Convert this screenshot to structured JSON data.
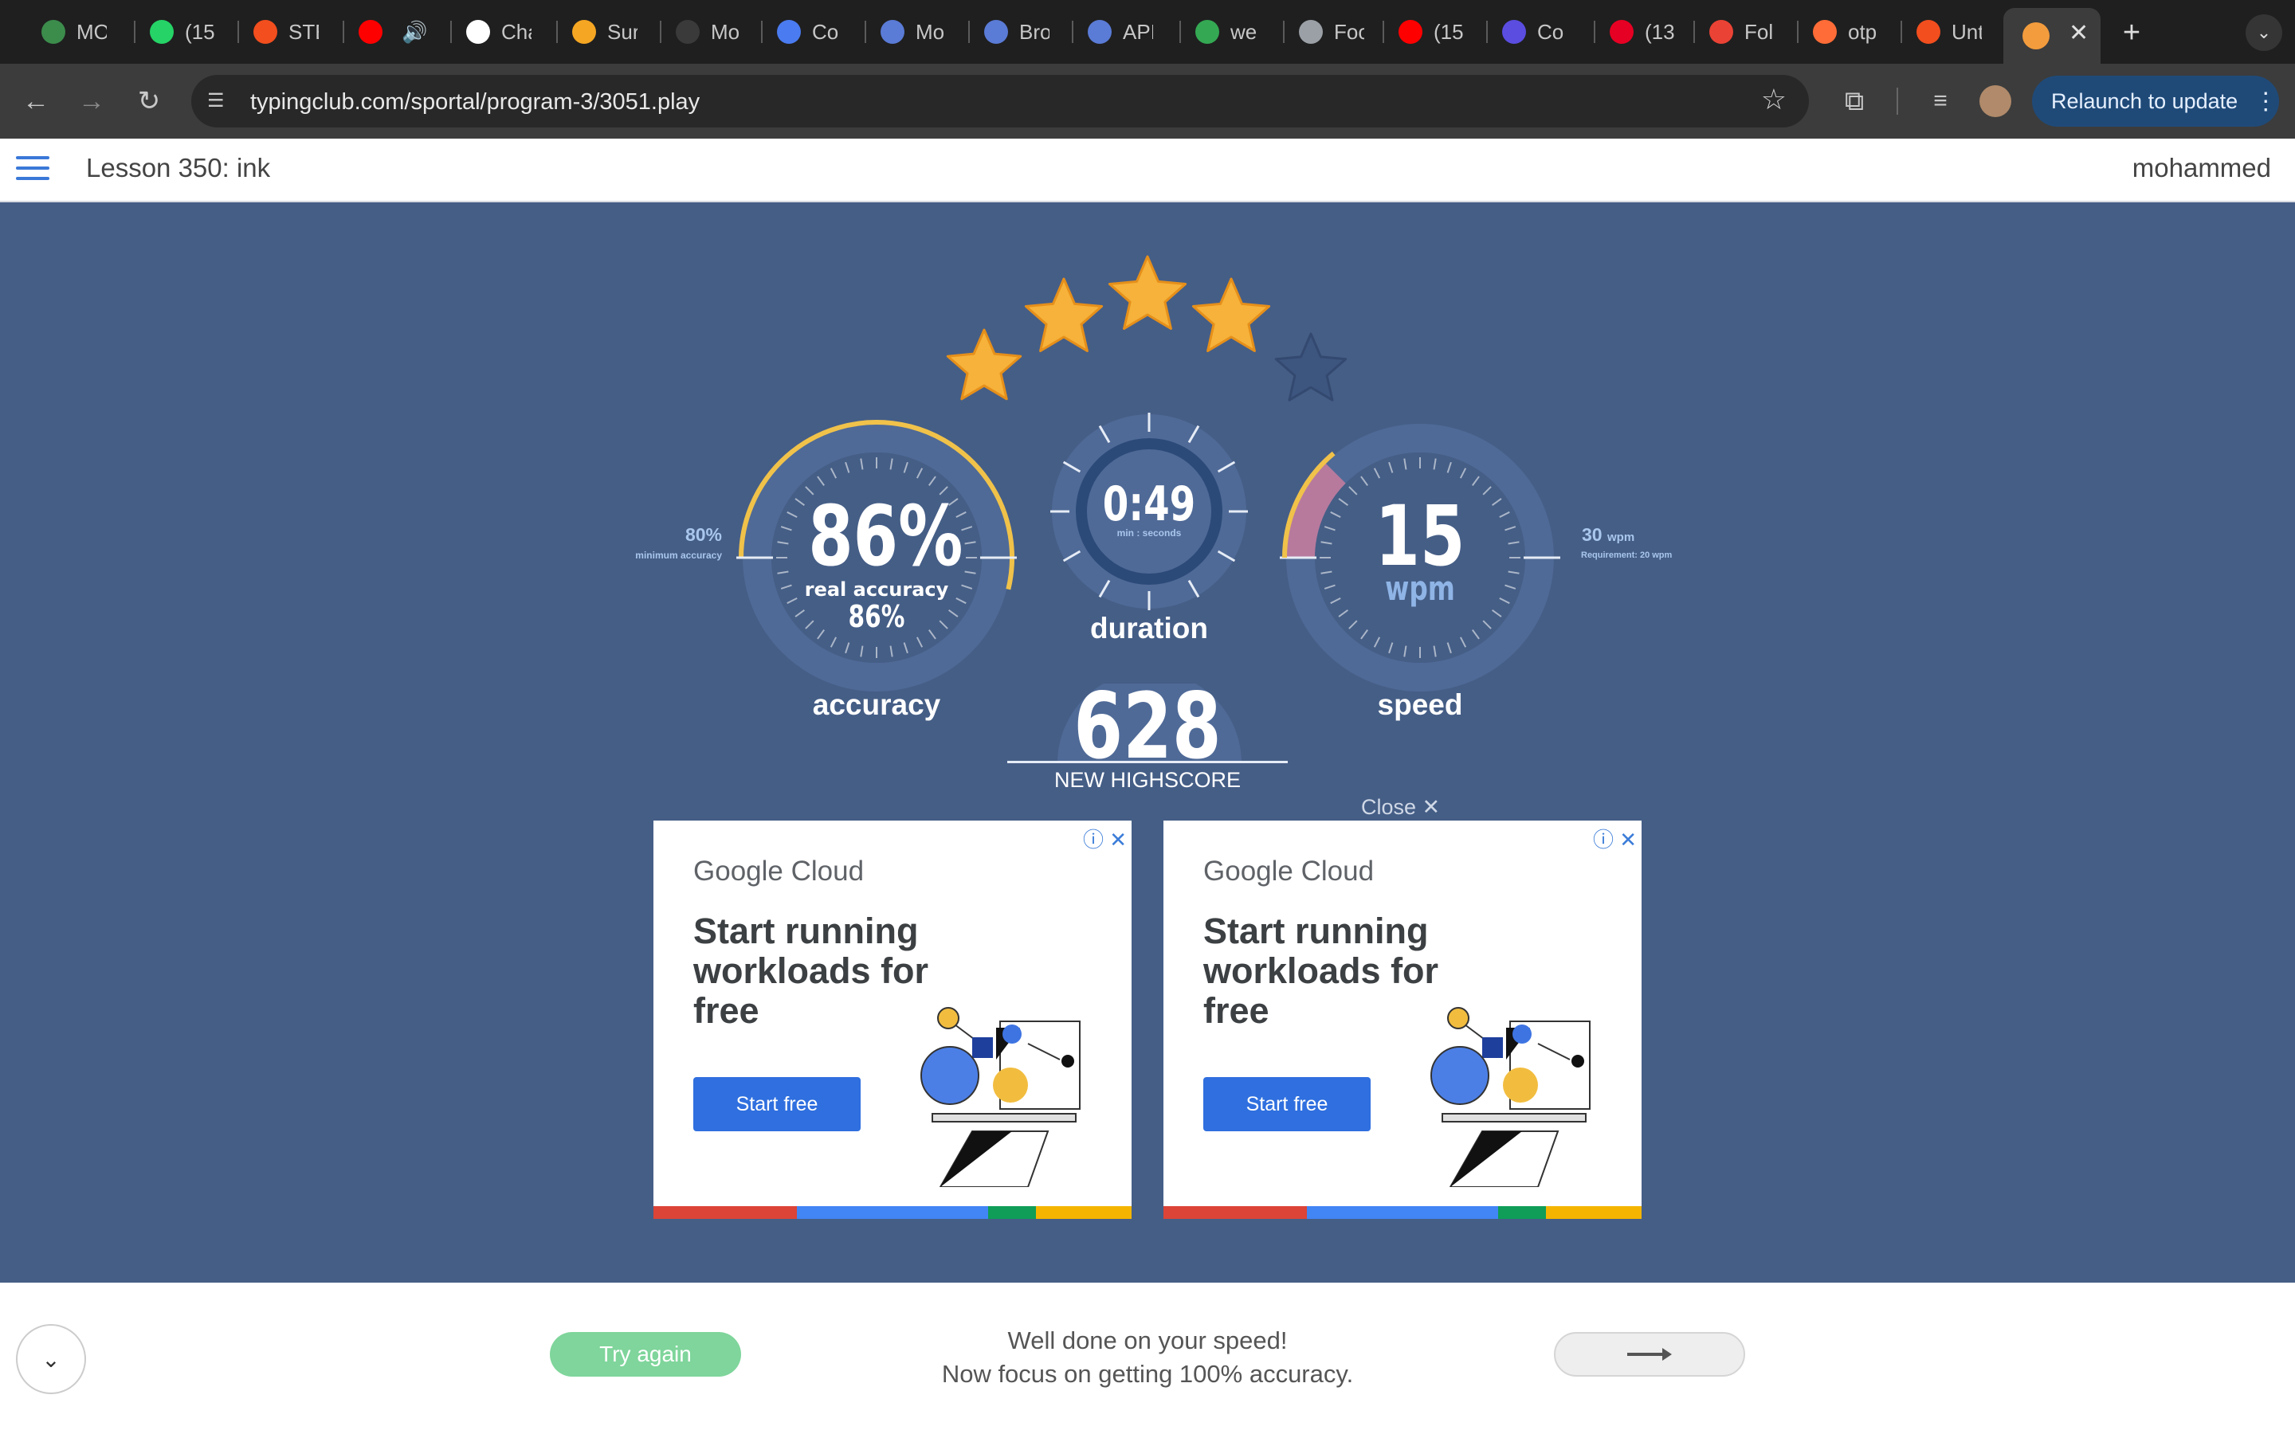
{
  "browser": {
    "tabs": [
      {
        "label": "MO",
        "icon": "globe-plus-icon",
        "color": "#3c8c4c"
      },
      {
        "label": "(15",
        "icon": "whatsapp-icon",
        "color": "#25d366"
      },
      {
        "label": "STE",
        "icon": "figma-icon",
        "color": "#f24e1e"
      },
      {
        "label": "",
        "icon": "youtube-icon",
        "color": "#ff0000"
      },
      {
        "label": "Cha",
        "icon": "chatgpt-icon",
        "color": "#ffffff"
      },
      {
        "label": "Sur",
        "icon": "surfshark-icon",
        "color": "#f5a623"
      },
      {
        "label": "Mo",
        "icon": "mt-icon",
        "color": "#3a3a3a"
      },
      {
        "label": "Co",
        "icon": "docs-icon",
        "color": "#4a7bf0"
      },
      {
        "label": "Mo",
        "icon": "browser-icon",
        "color": "#5a7bd6"
      },
      {
        "label": "Bro",
        "icon": "browser-icon",
        "color": "#5a7bd6"
      },
      {
        "label": "API",
        "icon": "browser-icon",
        "color": "#5a7bd6"
      },
      {
        "label": "we",
        "icon": "drive-icon",
        "color": "#34a853"
      },
      {
        "label": "Foo",
        "icon": "globe-icon",
        "color": "#9aa0a6"
      },
      {
        "label": "(15",
        "icon": "youtube-icon",
        "color": "#ff0000"
      },
      {
        "label": "Co",
        "icon": "colab-icon",
        "color": "#5a4de0"
      },
      {
        "label": "(13",
        "icon": "pinterest-icon",
        "color": "#e60023"
      },
      {
        "label": "Fol",
        "icon": "gmail-icon",
        "color": "#ea4335"
      },
      {
        "label": "otp",
        "icon": "postman-icon",
        "color": "#ff6c37"
      },
      {
        "label": "Unt",
        "icon": "figma-icon",
        "color": "#f24e1e"
      }
    ],
    "active_tab_icon": "typingclub-icon",
    "url": "typingclub.com/sportal/program-3/3051.play",
    "relaunch_label": "Relaunch to update"
  },
  "header": {
    "lesson_title": "Lesson 350: ink",
    "username": "mohammed"
  },
  "stars": {
    "earned": 4,
    "total": 5
  },
  "accuracy": {
    "value": "86%",
    "real_label": "real accuracy",
    "real_value": "86%",
    "label": "accuracy",
    "min_value": "80%",
    "min_label": "minimum accuracy",
    "fraction": 0.86
  },
  "duration": {
    "value": "0:49",
    "unit": "min : seconds",
    "label": "duration"
  },
  "speed": {
    "value": "15",
    "unit": "wpm",
    "label": "speed",
    "target_value": "30",
    "target_unit": "wpm",
    "requirement": "Requirement: 20 wpm",
    "fraction": 0.5
  },
  "score": {
    "value": "628",
    "label": "NEW HIGHSCORE"
  },
  "ads": {
    "close_label": "Close",
    "items": [
      {
        "brand": "Google Cloud",
        "headline": "Start running workloads for free",
        "cta": "Start free"
      },
      {
        "brand": "Google Cloud",
        "headline": "Start running workloads for free",
        "cta": "Start free"
      }
    ],
    "bar_colors": [
      "#db4437",
      "#4285f4",
      "#0f9d58",
      "#f4b400"
    ]
  },
  "footer": {
    "try_again": "Try again",
    "message_line1": "Well done on your speed!",
    "message_line2": "Now focus on getting 100% accuracy."
  },
  "colors": {
    "background": "#455e86",
    "gauge_track": "#4f6a97",
    "accuracy_arc": "#f0c24a",
    "speed_arc": "#b77a9d",
    "star_gold": "#f6b23a",
    "star_empty": "#3d5680"
  }
}
